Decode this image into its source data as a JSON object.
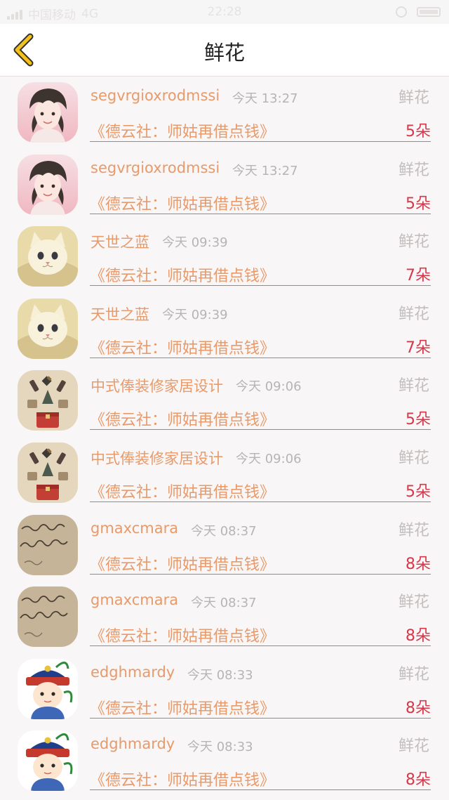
{
  "status_bar": {
    "carrier": "中国移动",
    "network": "4G",
    "time": "22:28"
  },
  "nav": {
    "title": "鲜花",
    "back_icon": "chevron-left-icon",
    "back_color": "#f2c11c"
  },
  "colors": {
    "name": "#e89a6a",
    "count": "#d8374a",
    "muted": "#b7b4b4"
  },
  "items": [
    {
      "name": "segvrgioxrodmssi",
      "time": "今天 13:27",
      "kind": "鲜花",
      "work": "《德云社：师姑再借点钱》",
      "count": "5朵",
      "avatar": "anime-boy"
    },
    {
      "name": "segvrgioxrodmssi",
      "time": "今天 13:27",
      "kind": "鲜花",
      "work": "《德云社：师姑再借点钱》",
      "count": "5朵",
      "avatar": "anime-boy"
    },
    {
      "name": "天世之蓝",
      "time": "今天 09:39",
      "kind": "鲜花",
      "work": "《德云社：师姑再借点钱》",
      "count": "7朵",
      "avatar": "cat"
    },
    {
      "name": "天世之蓝",
      "time": "今天 09:39",
      "kind": "鲜花",
      "work": "《德云社：师姑再借点钱》",
      "count": "7朵",
      "avatar": "cat"
    },
    {
      "name": "中式俸装修家居设计",
      "time": "今天 09:06",
      "kind": "鲜花",
      "work": "《德云社：师姑再借点钱》",
      "count": "5朵",
      "avatar": "flatlay"
    },
    {
      "name": "中式俸装修家居设计",
      "time": "今天 09:06",
      "kind": "鲜花",
      "work": "《德云社：师姑再借点钱》",
      "count": "5朵",
      "avatar": "flatlay"
    },
    {
      "name": "gmaxcmara",
      "time": "今天 08:37",
      "kind": "鲜花",
      "work": "《德云社：师姑再借点钱》",
      "count": "8朵",
      "avatar": "handwriting"
    },
    {
      "name": "gmaxcmara",
      "time": "今天 08:37",
      "kind": "鲜花",
      "work": "《德云社：师姑再借点钱》",
      "count": "8朵",
      "avatar": "handwriting"
    },
    {
      "name": "edghmardy",
      "time": "今天 08:33",
      "kind": "鲜花",
      "work": "《德云社：师姑再借点钱》",
      "count": "8朵",
      "avatar": "cartoon-official"
    },
    {
      "name": "edghmardy",
      "time": "今天 08:33",
      "kind": "鲜花",
      "work": "《德云社：师姑再借点钱》",
      "count": "8朵",
      "avatar": "cartoon-official"
    }
  ]
}
